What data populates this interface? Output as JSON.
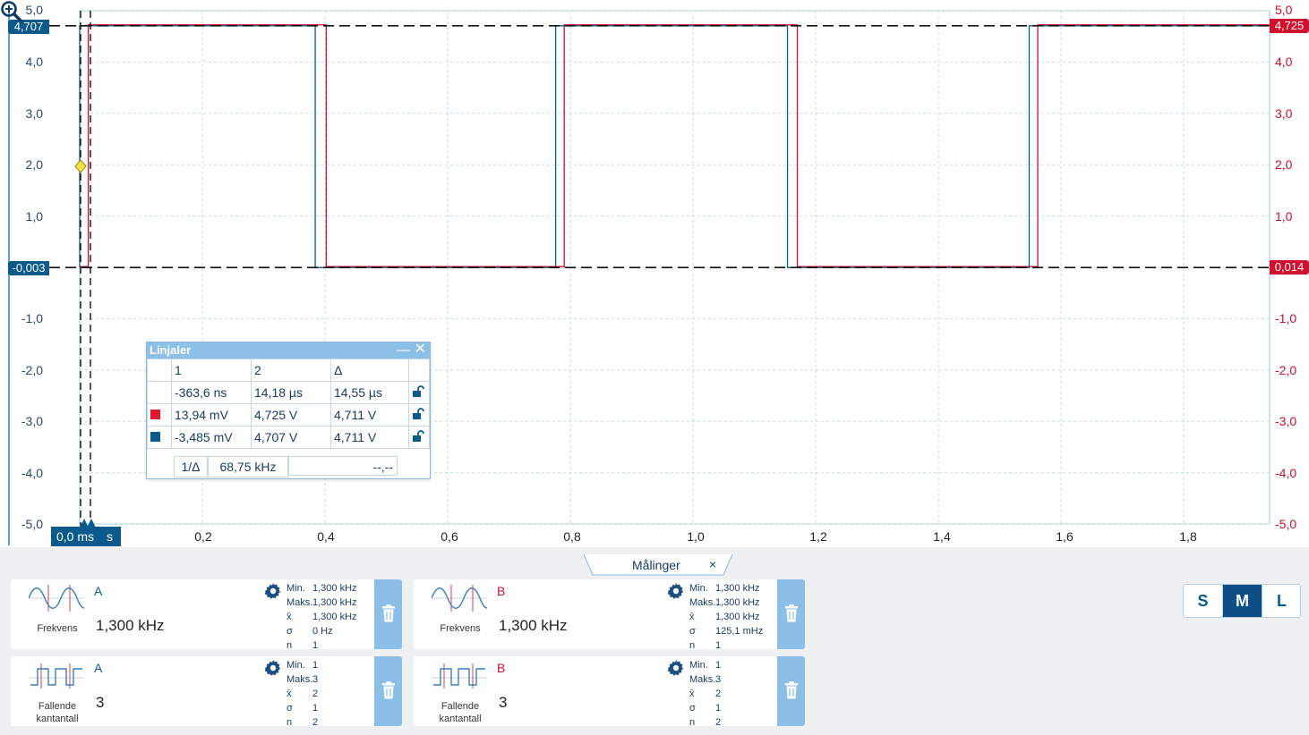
{
  "scope": {
    "y_labels": [
      "5,0",
      "4,0",
      "3,0",
      "2,0",
      "1,0",
      "",
      "-1,0",
      "-2,0",
      "-3,0",
      "-4,0",
      "-5,0"
    ],
    "x_labels": [
      "0,2",
      "0,4",
      "0,6",
      "0,8",
      "1,0",
      "1,2",
      "1,4",
      "1,6",
      "1,8"
    ],
    "cursor_left_top": "4,707",
    "cursor_left_bottom": "-0,003",
    "cursor_right_top": "4,725",
    "cursor_right_bottom": "0,014",
    "time_value": "0,0 ms",
    "time_unit": "s",
    "colors": {
      "channel_a": "#d0102e",
      "channel_b": "#0b5a8c",
      "grid": "#c7dce8"
    }
  },
  "chart_data": {
    "type": "line",
    "xlim": [
      0,
      1.94
    ],
    "ylim": [
      -5,
      5
    ],
    "x_ticks": [
      0.2,
      0.4,
      0.6,
      0.8,
      1.0,
      1.2,
      1.4,
      1.6,
      1.8
    ],
    "y_ticks": [
      -5,
      -4,
      -3,
      -2,
      -1,
      0,
      1,
      2,
      3,
      4,
      5
    ],
    "series": [
      {
        "color": "#d0102e",
        "low": 0.014,
        "high": 4.725,
        "rising": [
          0.014,
          0.79,
          1.562
        ],
        "falling": [
          0.402,
          1.17
        ]
      },
      {
        "color": "#0b5a8c",
        "low": -0.003,
        "high": 4.707,
        "rising": [
          0.0,
          0.776,
          1.548
        ],
        "falling": [
          0.384,
          1.154
        ]
      }
    ]
  },
  "rulers": {
    "title": "Linjaler",
    "headers": [
      "1",
      "2",
      "Δ"
    ],
    "rows": [
      {
        "c1": "-363,6 ns",
        "c2": "14,18 µs",
        "c3": "14,55 µs"
      },
      {
        "c1": "13,94 mV",
        "c2": "4,725 V",
        "c3": "4,711 V"
      },
      {
        "c1": "-3,485 mV",
        "c2": "4,707 V",
        "c3": "4,711 V"
      }
    ],
    "inverse_label": "1/Δ",
    "inverse_value": "68,75 kHz",
    "inverse_extra": "--,--"
  },
  "measurements": {
    "tab_label": "Målinger",
    "tab_close": "×",
    "cards": [
      {
        "channel": "A",
        "name1": "Frekvens",
        "name2": "",
        "value": "1,300 kHz",
        "stats": [
          [
            "Min.",
            "1,300 kHz"
          ],
          [
            "Maks.",
            "1,300 kHz"
          ],
          [
            "x̄",
            "1,300 kHz"
          ],
          [
            "σ",
            "0 Hz"
          ],
          [
            "n",
            "1"
          ]
        ]
      },
      {
        "channel": "B",
        "name1": "Frekvens",
        "name2": "",
        "value": "1,300 kHz",
        "stats": [
          [
            "Min.",
            "1,300 kHz"
          ],
          [
            "Maks.",
            "1,300 kHz"
          ],
          [
            "x̄",
            "1,300 kHz"
          ],
          [
            "σ",
            "125,1 mHz"
          ],
          [
            "n",
            "1"
          ]
        ]
      },
      {
        "channel": "A",
        "name1": "Fallende",
        "name2": "kantantall",
        "value": "3",
        "stats": [
          [
            "Min.",
            "1"
          ],
          [
            "Maks.",
            "3"
          ],
          [
            "x̄",
            "2"
          ],
          [
            "σ",
            "1"
          ],
          [
            "n",
            "2"
          ]
        ]
      },
      {
        "channel": "B",
        "name1": "Fallende",
        "name2": "kantantall",
        "value": "3",
        "stats": [
          [
            "Min.",
            "1"
          ],
          [
            "Maks.",
            "3"
          ],
          [
            "x̄",
            "2"
          ],
          [
            "σ",
            "1"
          ],
          [
            "n",
            "2"
          ]
        ]
      }
    ]
  },
  "size_buttons": [
    "S",
    "M",
    "L"
  ],
  "size_selected": "M"
}
